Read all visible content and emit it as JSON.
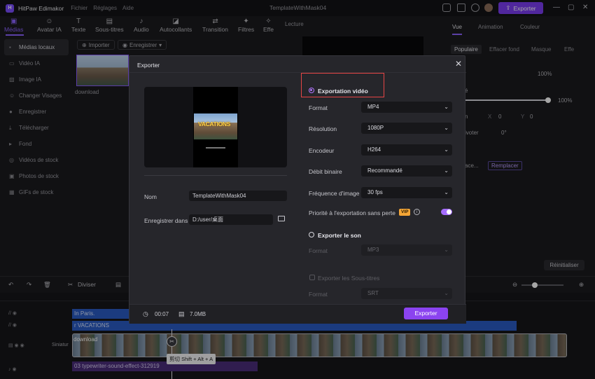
{
  "window": {
    "app_name": "HitPaw Edimakor",
    "menus": [
      "Fichier",
      "Réglages",
      "Aide"
    ],
    "doc_title": "TemplateWithMask04",
    "export_label": "Exporter"
  },
  "toolbar": {
    "tools": [
      "Médias",
      "Avatar IA",
      "Texte",
      "Sous-titres",
      "Audio",
      "Autocollants",
      "Transition",
      "Filtres",
      "Effe"
    ],
    "active": "Médias"
  },
  "sidebar": {
    "items": [
      "Médias locaux",
      "Vidéo IA",
      "Image IA",
      "Changer Visages",
      "Enregistrer",
      "Télécharger",
      "Fond",
      "Vidéos de stock",
      "Photos de stock",
      "GIFs de stock"
    ]
  },
  "media": {
    "import_label": "Importer",
    "record_label": "Enregistrer",
    "thumb_label": "download"
  },
  "preview": {
    "header": "Lecture"
  },
  "right_panel": {
    "tabs": [
      "Vue",
      "Animation",
      "Couleur"
    ],
    "subtabs": [
      "Populaire",
      "Effacer fond",
      "Masque",
      "Effe"
    ],
    "pct1": "100%",
    "pct2": "100%",
    "x_label": "X",
    "x_value": "0",
    "y_label": "Y",
    "y_value": "0",
    "rot_label": "ivoter",
    "rot_value": "0°",
    "rot_partial": "é",
    "ace_label": "ace...",
    "replace_label": "Remplacer",
    "reset_label": "Réinitialiser",
    "misc_label": "n"
  },
  "timeline": {
    "split_label": "Diviser",
    "clips": {
      "text1": "In Paris.",
      "text2": "r VACATIONS",
      "video": "download",
      "audio": "03 typewriter-sound-effect-312919",
      "track_label": "Siniatur"
    },
    "tooltip": "剪切 Shift + Alt + A"
  },
  "export_dialog": {
    "title": "Exporter",
    "preview_caption": "VACATIONS",
    "name_label": "Nom",
    "name_value": "TemplateWithMask04",
    "save_label": "Enregistrer dans",
    "save_value": "D:/user/桌面",
    "video_export_label": "Exportation vidéo",
    "format_label": "Format",
    "format_value": "MP4",
    "resolution_label": "Résolution",
    "resolution_value": "1080P",
    "encoder_label": "Encodeur",
    "encoder_value": "H264",
    "bitrate_label": "Débit binaire",
    "bitrate_value": "Recommandé",
    "fps_label": "Fréquence d'image",
    "fps_value": "30  fps",
    "lossless_label": "Priorité à l'exportation sans perte",
    "vip_label": "VIP",
    "sound_export_label": "Exporter le son",
    "sound_format_label": "Format",
    "sound_format_value": "MP3",
    "subtitle_export_label": "Exporter les Sous-titres",
    "subtitle_format_label": "Format",
    "subtitle_format_value": "SRT",
    "duration": "00:07",
    "size": "7.0MB",
    "export_button": "Exporter"
  },
  "colors": {
    "accent": "#8b43f0",
    "highlight_box": "#e64545",
    "vip_badge": "#f3a536"
  }
}
